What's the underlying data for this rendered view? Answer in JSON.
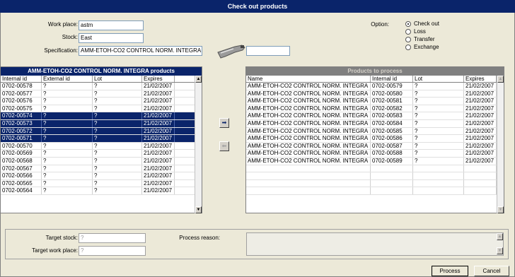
{
  "window": {
    "title": "Check out products"
  },
  "form": {
    "work_place_label": "Work place:",
    "work_place_value": "astm",
    "stock_label": "Stock:",
    "stock_value": "East",
    "specification_label": "Specification:",
    "specification_value": "AMM-ETOH-CO2 CONTROL NORM. INTEGRA",
    "barcode_value": ""
  },
  "option": {
    "label": "Option:",
    "choices": [
      "Check out",
      "Loss",
      "Transfer",
      "Exchange"
    ],
    "selected": "Check out"
  },
  "left_panel": {
    "title": "AMM-ETOH-CO2 CONTROL NORM. INTEGRA products",
    "columns": [
      "Internal id",
      "External id",
      "Lot",
      "Expires"
    ],
    "rows": [
      {
        "internal_id": "0702-00578",
        "external_id": "?",
        "lot": "?",
        "expires": "21/02/2007",
        "selected": false
      },
      {
        "internal_id": "0702-00577",
        "external_id": "?",
        "lot": "?",
        "expires": "21/02/2007",
        "selected": false
      },
      {
        "internal_id": "0702-00576",
        "external_id": "?",
        "lot": "?",
        "expires": "21/02/2007",
        "selected": false
      },
      {
        "internal_id": "0702-00575",
        "external_id": "?",
        "lot": "?",
        "expires": "21/02/2007",
        "selected": false
      },
      {
        "internal_id": "0702-00574",
        "external_id": "?",
        "lot": "?",
        "expires": "21/02/2007",
        "selected": true
      },
      {
        "internal_id": "0702-00573",
        "external_id": "?",
        "lot": "?",
        "expires": "21/02/2007",
        "selected": true
      },
      {
        "internal_id": "0702-00572",
        "external_id": "?",
        "lot": "?",
        "expires": "21/02/2007",
        "selected": true
      },
      {
        "internal_id": "0702-00571",
        "external_id": "?",
        "lot": "?",
        "expires": "21/02/2007",
        "selected": true
      },
      {
        "internal_id": "0702-00570",
        "external_id": "?",
        "lot": "?",
        "expires": "21/02/2007",
        "selected": false
      },
      {
        "internal_id": "0702-00569",
        "external_id": "?",
        "lot": "?",
        "expires": "21/02/2007",
        "selected": false
      },
      {
        "internal_id": "0702-00568",
        "external_id": "?",
        "lot": "?",
        "expires": "21/02/2007",
        "selected": false
      },
      {
        "internal_id": "0702-00567",
        "external_id": "?",
        "lot": "?",
        "expires": "21/02/2007",
        "selected": false
      },
      {
        "internal_id": "0702-00566",
        "external_id": "?",
        "lot": "?",
        "expires": "21/02/2007",
        "selected": false
      },
      {
        "internal_id": "0702-00565",
        "external_id": "?",
        "lot": "?",
        "expires": "21/02/2007",
        "selected": false
      },
      {
        "internal_id": "0702-00564",
        "external_id": "?",
        "lot": "?",
        "expires": "21/02/2007",
        "selected": false
      }
    ]
  },
  "right_panel": {
    "title": "Products to process",
    "columns": [
      "Name",
      "Internal id",
      "Lot",
      "Expires"
    ],
    "rows": [
      {
        "name": "AMM-ETOH-CO2 CONTROL NORM. INTEGRA",
        "internal_id": "0702-00579",
        "lot": "?",
        "expires": "21/02/2007"
      },
      {
        "name": "AMM-ETOH-CO2 CONTROL NORM. INTEGRA",
        "internal_id": "0702-00580",
        "lot": "?",
        "expires": "21/02/2007"
      },
      {
        "name": "AMM-ETOH-CO2 CONTROL NORM. INTEGRA",
        "internal_id": "0702-00581",
        "lot": "?",
        "expires": "21/02/2007"
      },
      {
        "name": "AMM-ETOH-CO2 CONTROL NORM. INTEGRA",
        "internal_id": "0702-00582",
        "lot": "?",
        "expires": "21/02/2007"
      },
      {
        "name": "AMM-ETOH-CO2 CONTROL NORM. INTEGRA",
        "internal_id": "0702-00583",
        "lot": "?",
        "expires": "21/02/2007"
      },
      {
        "name": "AMM-ETOH-CO2 CONTROL NORM. INTEGRA",
        "internal_id": "0702-00584",
        "lot": "?",
        "expires": "21/02/2007"
      },
      {
        "name": "AMM-ETOH-CO2 CONTROL NORM. INTEGRA",
        "internal_id": "0702-00585",
        "lot": "?",
        "expires": "21/02/2007"
      },
      {
        "name": "AMM-ETOH-CO2 CONTROL NORM. INTEGRA",
        "internal_id": "0702-00586",
        "lot": "?",
        "expires": "21/02/2007"
      },
      {
        "name": "AMM-ETOH-CO2 CONTROL NORM. INTEGRA",
        "internal_id": "0702-00587",
        "lot": "?",
        "expires": "21/02/2007"
      },
      {
        "name": "AMM-ETOH-CO2 CONTROL NORM. INTEGRA",
        "internal_id": "0702-00588",
        "lot": "?",
        "expires": "21/02/2007"
      },
      {
        "name": "AMM-ETOH-CO2 CONTROL NORM. INTEGRA",
        "internal_id": "0702-00589",
        "lot": "?",
        "expires": "21/02/2007"
      }
    ]
  },
  "move": {
    "add_icon": "arrow-right-icon",
    "remove_icon": "arrow-left-icon"
  },
  "bottom": {
    "target_stock_label": "Target stock:",
    "target_stock_value": "?",
    "target_work_place_label": "Target work place:",
    "target_work_place_value": "?",
    "process_reason_label": "Process reason:",
    "process_reason_value": ""
  },
  "buttons": {
    "process": "Process",
    "cancel": "Cancel"
  }
}
